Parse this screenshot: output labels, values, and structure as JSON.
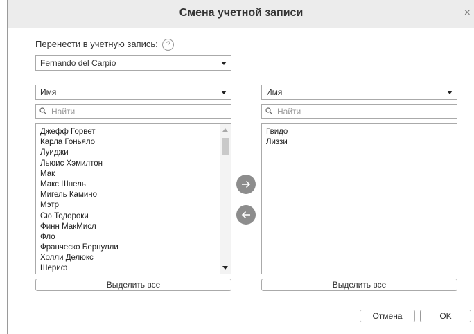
{
  "dialog": {
    "title": "Смена учетной записи",
    "close_glyph": "×"
  },
  "transfer": {
    "label": "Перенести в учетную запись:",
    "help_glyph": "?",
    "account": "Fernando del Carpio"
  },
  "left": {
    "sort": "Имя",
    "search_placeholder": "Найти",
    "items": [
      "Джефф Горвет",
      "Карла Гоньяло",
      "Луиджи",
      "Льюис Хэмилтон",
      "Мак",
      "Макс Шнель",
      "Мигель Камино",
      "Мэтр",
      "Сю Тодороки",
      "Финн МакМисл",
      "Фло",
      "Франческо Бернулли",
      "Холли Делюкс",
      "Шериф"
    ],
    "select_all": "Выделить все"
  },
  "right": {
    "sort": "Имя",
    "search_placeholder": "Найти",
    "items": [
      "Гвидо",
      "Лиззи"
    ],
    "select_all": "Выделить все"
  },
  "buttons": {
    "cancel": "Отмена",
    "ok": "OK"
  },
  "icons": {
    "move_right": "arrow-right-icon",
    "move_left": "arrow-left-icon",
    "search": "search-icon",
    "close": "close-icon",
    "help": "help-icon"
  },
  "colors": {
    "titlebar_bg": "#ececec",
    "arrow_button": "#8d8d8d",
    "border": "#aaaaaa"
  }
}
